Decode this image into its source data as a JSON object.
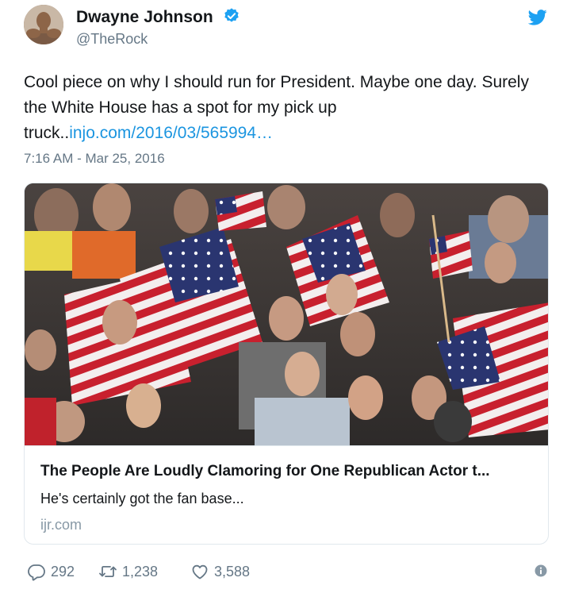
{
  "user": {
    "name": "Dwayne Johnson",
    "handle": "@TheRock",
    "verified": true,
    "avatar": "profile-photo"
  },
  "tweet": {
    "text": "Cool piece on why I should run for President. Maybe one day. Surely the White House has a spot for my pick up truck..",
    "link_text": "injo.com/2016/03/565994…",
    "timestamp": "7:16 AM - Mar 25, 2016"
  },
  "card": {
    "image": "crowd-with-american-flags-photo",
    "title": "The People Are Loudly Clamoring for One Republican Actor t...",
    "description": "He's certainly got the fan base...",
    "domain": "ijr.com"
  },
  "actions": {
    "replies": "292",
    "retweets": "1,238",
    "likes": "3,588"
  },
  "colors": {
    "link": "#1b95e0",
    "secondary_text": "#657786",
    "border": "#e1e8ed",
    "twitter_blue": "#1da1f2"
  }
}
